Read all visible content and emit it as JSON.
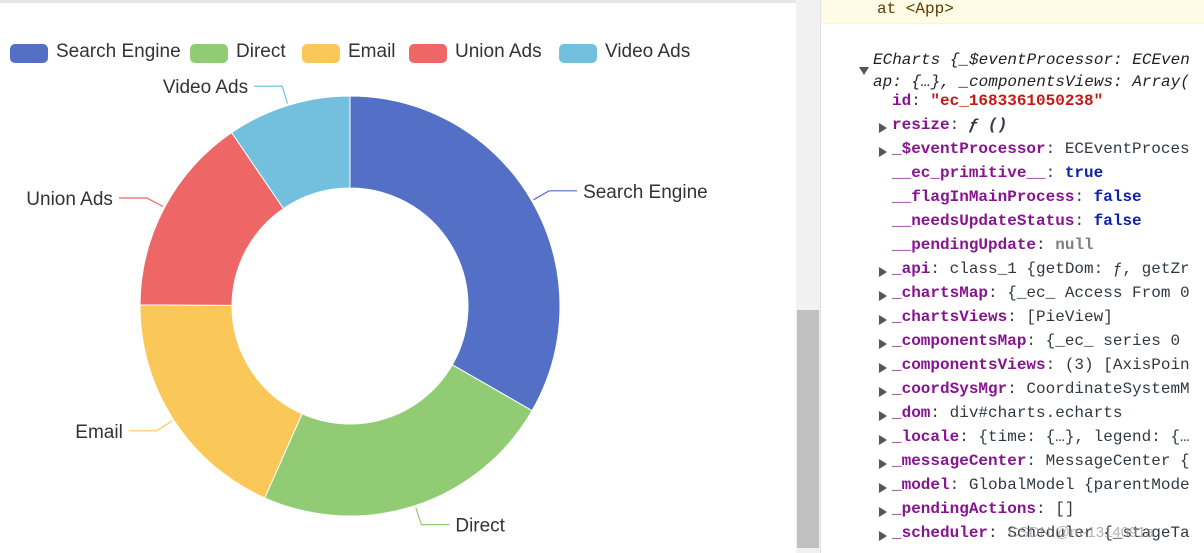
{
  "chart_data": {
    "type": "pie",
    "categories": [
      "Search Engine",
      "Direct",
      "Email",
      "Union Ads",
      "Video Ads"
    ],
    "values": [
      1048,
      735,
      580,
      484,
      300
    ],
    "colors": [
      "#5470c6",
      "#91cc75",
      "#fac858",
      "#ee6666",
      "#73c0de"
    ],
    "legend_position": "top-left",
    "donut": true
  },
  "devtools": {
    "stack_line": "at <App>",
    "object_header": [
      "ECharts {_$eventProcessor: ECEven",
      "ap: {…}, _componentsViews: Array("
    ],
    "rows": [
      {
        "key": "id",
        "sep": ": ",
        "value": "\"ec_1683361050238\"",
        "cls": "str",
        "expand": false
      },
      {
        "key": "resize",
        "sep": ": ",
        "value": "ƒ ()",
        "cls": "fn",
        "expand": true
      },
      {
        "key": "_$eventProcessor",
        "sep": ": ",
        "value": "ECEventProces",
        "cls": "v",
        "expand": true
      },
      {
        "key": "__ec_primitive__",
        "sep": ": ",
        "value": "true",
        "cls": "kw",
        "expand": false
      },
      {
        "key": "__flagInMainProcess",
        "sep": ": ",
        "value": "false",
        "cls": "kw",
        "expand": false
      },
      {
        "key": "__needsUpdateStatus",
        "sep": ": ",
        "value": "false",
        "cls": "kw",
        "expand": false
      },
      {
        "key": "__pendingUpdate",
        "sep": ": ",
        "value": "null",
        "cls": "null",
        "expand": false
      },
      {
        "key": "_api",
        "sep": ": ",
        "value": "class_1 {getDom: ƒ, getZr",
        "cls": "v",
        "expand": true
      },
      {
        "key": "_chartsMap",
        "sep": ": ",
        "value": "{_ec_ Access From 0",
        "cls": "v",
        "expand": true
      },
      {
        "key": "_chartsViews",
        "sep": ": ",
        "value": "[PieView]",
        "cls": "v",
        "expand": true
      },
      {
        "key": "_componentsMap",
        "sep": ": ",
        "value": "{_ec_ series 0",
        "cls": "v",
        "expand": true
      },
      {
        "key": "_componentsViews",
        "sep": ": ",
        "value": "(3) [AxisPoin",
        "cls": "v",
        "expand": true
      },
      {
        "key": "_coordSysMgr",
        "sep": ": ",
        "value": "CoordinateSystemM",
        "cls": "v",
        "expand": true
      },
      {
        "key": "_dom",
        "sep": ": ",
        "value": "div#charts.echarts",
        "cls": "v",
        "expand": true
      },
      {
        "key": "_locale",
        "sep": ": ",
        "value": "{time: {…}, legend: {…",
        "cls": "v",
        "expand": true
      },
      {
        "key": "_messageCenter",
        "sep": ": ",
        "value": "MessageCenter {",
        "cls": "v",
        "expand": true
      },
      {
        "key": "_model",
        "sep": ": ",
        "value": "GlobalModel {parentMode",
        "cls": "v",
        "expand": true
      },
      {
        "key": "_pendingActions",
        "sep": ": ",
        "value": "[]",
        "cls": "v",
        "expand": true
      },
      {
        "key": "_scheduler",
        "sep": ": ",
        "value": "Scheduler {_stageTa",
        "cls": "v",
        "expand": true
      }
    ]
  },
  "watermark": "CSDN @m-1314091a"
}
